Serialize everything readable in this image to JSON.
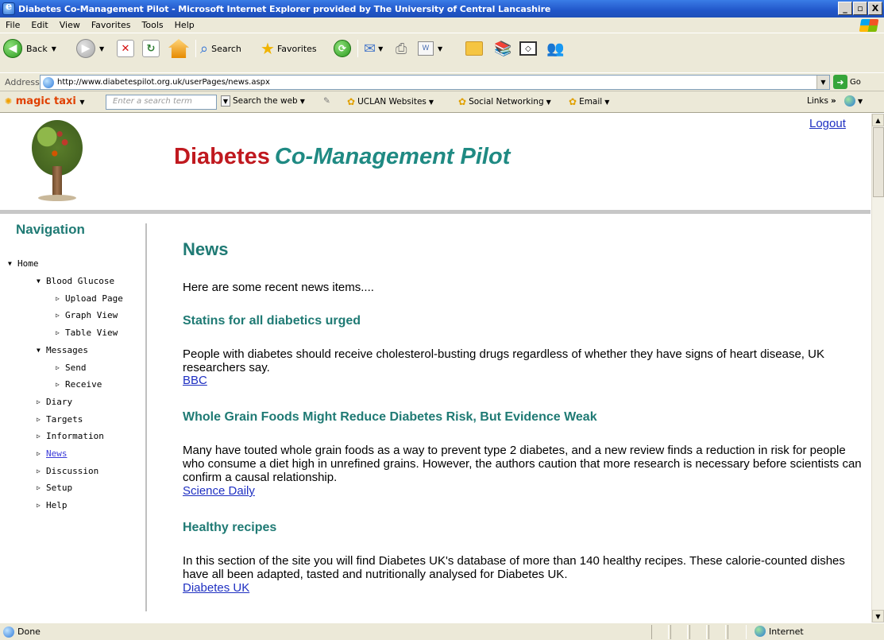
{
  "window": {
    "title": "Diabetes Co-Management Pilot - Microsoft Internet Explorer provided by The University of Central Lancashire",
    "minimize": "_",
    "maximize": "В",
    "close": "X"
  },
  "menu": [
    "File",
    "Edit",
    "View",
    "Favorites",
    "Tools",
    "Help"
  ],
  "toolbar": {
    "back": "Back",
    "search": "Search",
    "favorites": "Favorites"
  },
  "address": {
    "label": "Address",
    "url": "http://www.diabetespilot.org.uk/userPages/news.aspx",
    "go": "Go"
  },
  "linksbar": {
    "brand": "magic taxi",
    "search_placeholder": "Enter a search term",
    "search_web": "Search the web",
    "uclan": "UCLAN Websites",
    "social": "Social Networking",
    "email": "Email",
    "links": "Links"
  },
  "site": {
    "title_part1": "Diabetes",
    "title_part2": "Co-Management Pilot",
    "logout": "Logout"
  },
  "nav": {
    "title": "Navigation",
    "items": [
      {
        "label": "Home",
        "expanded": true
      },
      {
        "label": "Blood Glucose",
        "expanded": true
      },
      {
        "label": "Upload Page"
      },
      {
        "label": "Graph View"
      },
      {
        "label": "Table View"
      },
      {
        "label": "Messages",
        "expanded": true
      },
      {
        "label": "Send"
      },
      {
        "label": "Receive"
      },
      {
        "label": "Diary"
      },
      {
        "label": "Targets"
      },
      {
        "label": "Information"
      },
      {
        "label": "News",
        "active": true
      },
      {
        "label": "Discussion"
      },
      {
        "label": "Setup"
      },
      {
        "label": "Help"
      }
    ]
  },
  "main": {
    "heading": "News",
    "intro": "Here are some recent news items....",
    "items": [
      {
        "title": "Statins for all diabetics urged",
        "body": "People with diabetes should receive cholesterol-busting drugs regardless of whether they have signs of heart disease, UK researchers say.",
        "source": "BBC"
      },
      {
        "title": "Whole Grain Foods Might Reduce Diabetes Risk, But Evidence Weak",
        "body": "Many have touted whole grain foods as a way to prevent type 2 diabetes, and a new review finds a reduction in risk for people who consume a diet high in unrefined grains. However, the authors caution that more research is necessary before scientists can confirm a causal relationship.",
        "source": "Science Daily"
      },
      {
        "title": "Healthy recipes",
        "body": "In this section of the site you will find Diabetes UK's database of more than 140 healthy recipes. These calorie-counted dishes have all been adapted, tasted and nutritionally analysed for Diabetes UK.",
        "source": "Diabetes UK"
      }
    ]
  },
  "status": {
    "text": "Done",
    "zone": "Internet"
  }
}
